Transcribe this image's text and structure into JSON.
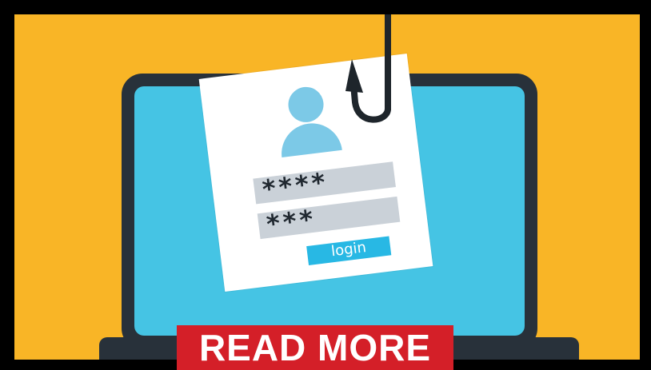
{
  "card": {
    "password_1": "****",
    "password_2": "***",
    "login_label": "login"
  },
  "cta": {
    "read_more_label": "READ MORE"
  },
  "colors": {
    "background": "#F9B526",
    "laptop_frame": "#28313A",
    "screen": "#45C4E4",
    "avatar": "#7CC9E7",
    "field": "#CAD1D8",
    "login_button": "#28B8E4",
    "read_more_button": "#D41F28"
  },
  "icons": {
    "avatar": "user-avatar-icon",
    "hook": "fish-hook-icon"
  }
}
